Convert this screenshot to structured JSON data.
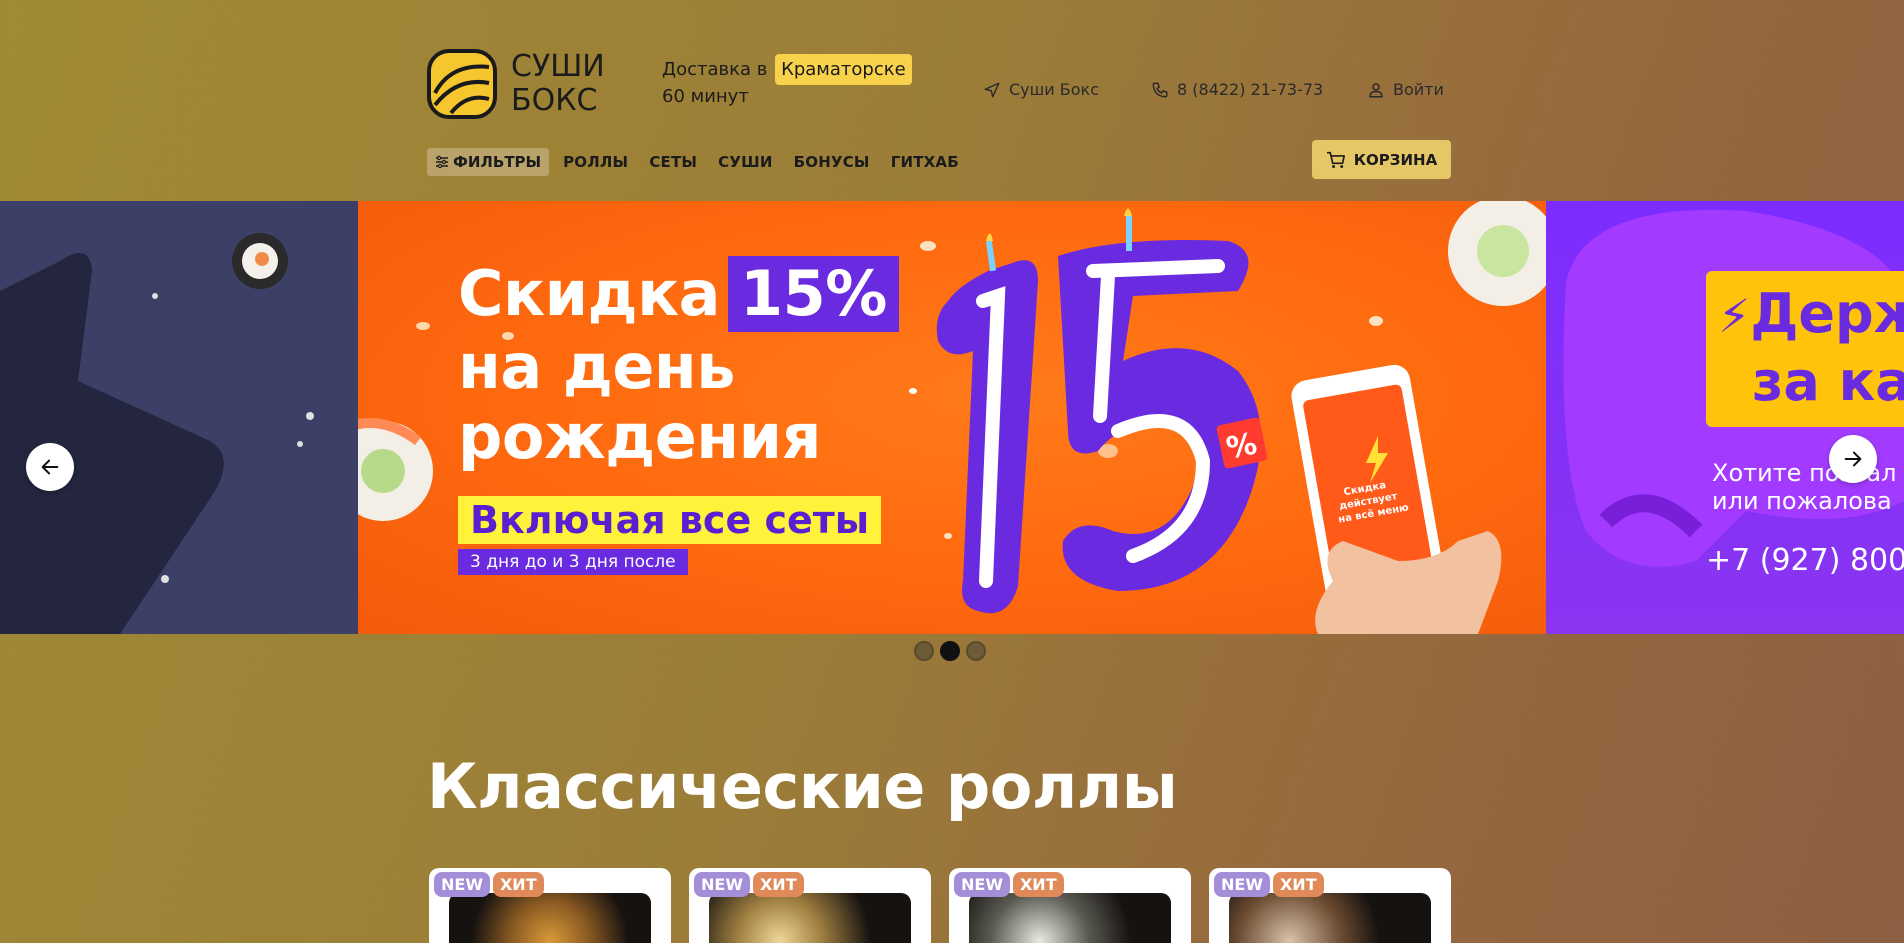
{
  "header": {
    "logo_line1": "СУШИ",
    "logo_line2": "БОКС",
    "delivery_prefix": "Доставка в",
    "city": "Краматорске",
    "delivery_time": "60 минут",
    "store_link": "Суши Бокс",
    "phone": "8 (8422) 21-73-73",
    "login": "Войти"
  },
  "nav": {
    "filters": "ФИЛЬТРЫ",
    "items": [
      "РОЛЛЫ",
      "СЕТЫ",
      "СУШИ",
      "БОНУСЫ",
      "ГИТХАБ"
    ],
    "cart": "КОРЗИНА"
  },
  "banner": {
    "main": {
      "title_line1": "Скидка",
      "percent": "15%",
      "title_line2": "на день",
      "title_line3": "рождения",
      "subtitle": "Включая все сеты",
      "note": "3 дня до и 3 дня после",
      "big_number": "15",
      "phone_text": "Скидка действует на всё меню"
    },
    "right": {
      "title_line1": "Держ",
      "title_line2": "за ка",
      "sub_line1": "Хотите позвал",
      "sub_line2": "или пожалова",
      "phone": "+7 (927) 800"
    },
    "slides_count": 3,
    "active_slide": 2
  },
  "section": {
    "title": "Классические роллы"
  },
  "products": [
    {
      "badges": [
        "NEW",
        "ХИТ"
      ]
    },
    {
      "badges": [
        "NEW",
        "ХИТ"
      ]
    },
    {
      "badges": [
        "NEW",
        "ХИТ"
      ]
    },
    {
      "badges": [
        "NEW",
        "ХИТ"
      ]
    }
  ],
  "colors": {
    "accent_yellow": "#f8d24a",
    "promo_orange": "#ff6a0f",
    "promo_purple": "#6a2be0",
    "badge_new": "#a48ed8",
    "badge_hit": "#e08a5a"
  }
}
